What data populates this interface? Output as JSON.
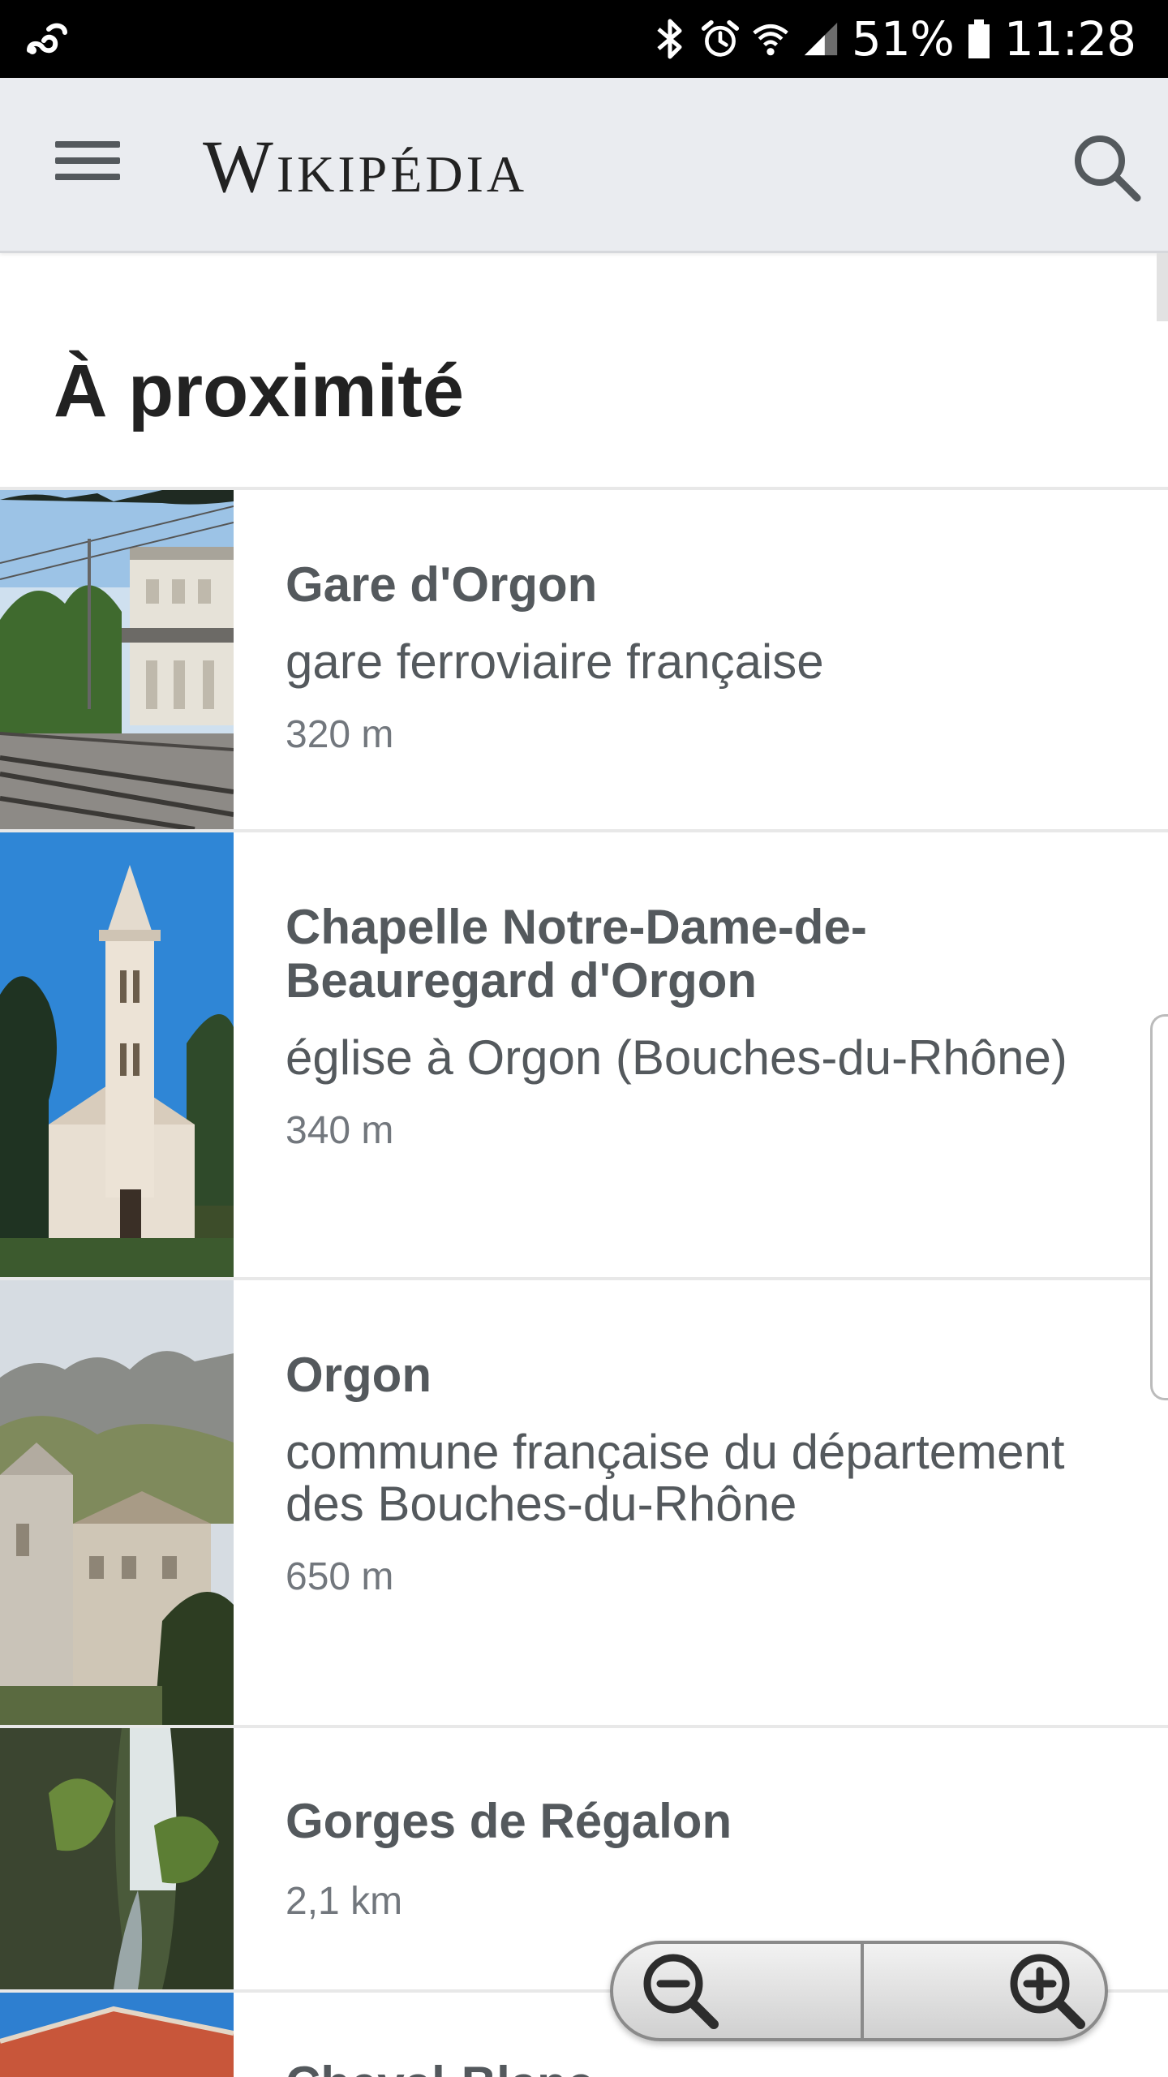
{
  "status_bar": {
    "battery_percent": "51%",
    "time": "11:28",
    "icons": [
      "link-icon",
      "bluetooth-icon",
      "alarm-icon",
      "wifi-icon",
      "signal-icon",
      "battery-icon"
    ]
  },
  "app_bar": {
    "wordmark": "Wikipédia",
    "menu_icon": "hamburger-menu-icon",
    "search_icon": "search-icon",
    "background": "#eaecf0"
  },
  "page": {
    "title": "À proximité"
  },
  "nearby": [
    {
      "title": "Gare d'Orgon",
      "description": "gare ferroviaire française",
      "distance": "320 m"
    },
    {
      "title": "Chapelle Notre-Dame-de-Beauregard d'Orgon",
      "description": "église à Orgon (Bouches-du-Rhône)",
      "distance": "340 m"
    },
    {
      "title": "Orgon",
      "description": "commune française du département des Bouches-du-Rhône",
      "distance": "650 m"
    },
    {
      "title": "Gorges de Régalon",
      "description": "",
      "distance": "2,1 km"
    },
    {
      "title": "Cheval-Blanc",
      "description": "",
      "distance": ""
    }
  ],
  "zoom_controls": {
    "zoom_out_icon": "zoom-out-icon",
    "zoom_in_icon": "zoom-in-icon"
  },
  "colors": {
    "text_primary": "#222222",
    "text_secondary": "#54595d",
    "text_tertiary": "#72777d",
    "divider": "#e8e8e8"
  }
}
